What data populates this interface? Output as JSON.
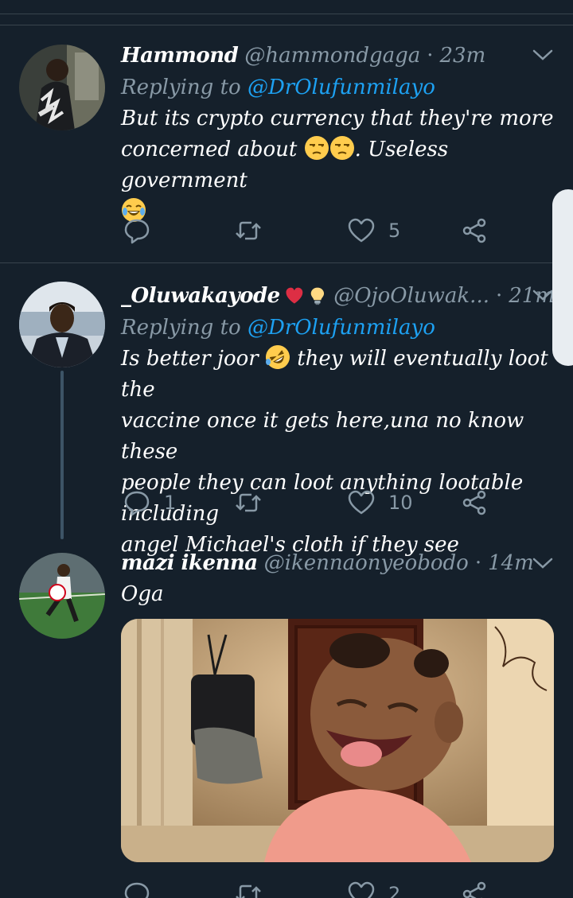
{
  "tweets": [
    {
      "name": "Hammond",
      "handle": "@hammondgaga",
      "time": "23m",
      "replying_prefix": "Replying to",
      "replying_to": "@DrOlufunmilayo",
      "text_line1": "But its crypto currency that they're more",
      "text_line2_a": "concerned about",
      "text_line2_b": ". Useless government",
      "emojis": [
        "unamused-face-icon",
        "unamused-face-icon",
        "tears-of-joy-icon"
      ],
      "reply_count": "",
      "retweet_count": "",
      "like_count": "5"
    },
    {
      "name": "_Oluwakayode",
      "name_emojis": [
        "red-heart-icon",
        "light-bulb-icon"
      ],
      "handle": "@OjoOluwak...",
      "time": "21m",
      "replying_prefix": "Replying to",
      "replying_to": "@DrOlufunmilayo",
      "text_line1_a": "Is better joor",
      "text_line1_b": "they will eventually loot the",
      "text_line2": "vaccine once it gets here,una no know these",
      "text_line3": "people they can loot anything lootable including",
      "text_line4": "angel Michael's cloth if they see",
      "emojis": [
        "rolling-on-floor-laughing-icon"
      ],
      "reply_count": "1",
      "retweet_count": "",
      "like_count": "10"
    },
    {
      "name": "mazi ikenna",
      "handle": "@ikennaonyeobodo",
      "time": "14m",
      "text": "Oga",
      "media": "photo-laughing-baby",
      "reply_count": "",
      "retweet_count": "",
      "like_count": "2"
    }
  ],
  "separator": "·",
  "colors": {
    "background": "#15202b",
    "divider": "#38444d",
    "secondary_text": "#8899a6",
    "mention": "#1da1f2",
    "heart": "#e0245e"
  }
}
